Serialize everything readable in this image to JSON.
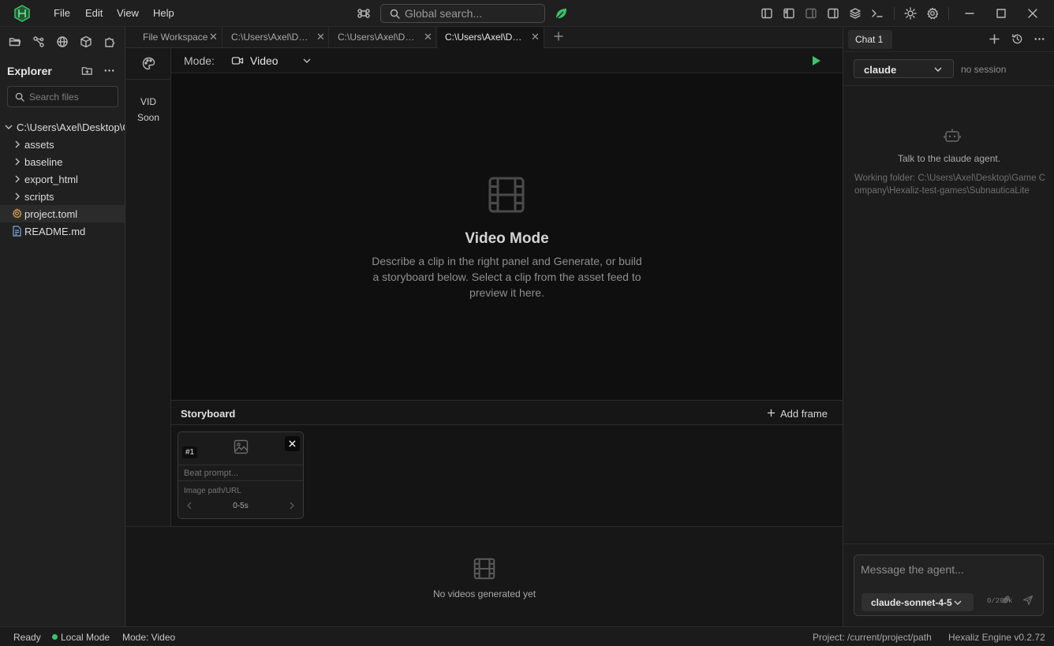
{
  "window": {
    "menu": [
      "File",
      "Edit",
      "View",
      "Help"
    ],
    "global_search_placeholder": "Global search...",
    "accent_color": "#3ec26b"
  },
  "explorer": {
    "title": "Explorer",
    "search_placeholder": "Search files",
    "root": "C:\\Users\\Axel\\Desktop\\Game Company\\Hexaliz-test-games\\SubnauticaLite",
    "items": [
      {
        "label": "assets",
        "type": "folder"
      },
      {
        "label": "baseline",
        "type": "folder"
      },
      {
        "label": "export_html",
        "type": "folder"
      },
      {
        "label": "scripts",
        "type": "folder"
      },
      {
        "label": "project.toml",
        "type": "config-file"
      },
      {
        "label": "README.md",
        "type": "markdown-file"
      }
    ]
  },
  "tabs": [
    {
      "label": "File Workspace"
    },
    {
      "label": "C:\\Users\\Axel\\Desktop"
    },
    {
      "label": "C:\\Users\\Axel\\Desktop"
    },
    {
      "label": "C:\\Users\\Axel\\Desktop"
    }
  ],
  "mode_side": {
    "badge": "VID",
    "note": "Soon"
  },
  "mode_bar": {
    "label": "Mode:",
    "value": "Video"
  },
  "preview": {
    "title": "Video Mode",
    "description": "Describe a clip in the right panel and Generate, or build a storyboard below. Select a clip from the asset feed to preview it here."
  },
  "storyboard": {
    "title": "Storyboard",
    "add_frame_label": "Add frame",
    "frames": [
      {
        "number": "#1",
        "prompt_placeholder": "Beat prompt...",
        "image_placeholder": "Image path/URL",
        "timing": "0-5s"
      }
    ]
  },
  "asset_feed": {
    "empty_text": "No videos generated yet"
  },
  "chat": {
    "tab_label": "Chat 1",
    "agent": "claude",
    "session_status": "no session",
    "empty_title": "Talk to the claude agent.",
    "working_folder_label": "Working folder:",
    "working_folder": "C:\\Users\\Axel\\Desktop\\Game Company\\Hexaliz-test-games\\SubnauticaLite",
    "message_placeholder": "Message the agent...",
    "model": "claude-sonnet-4-5",
    "char_count": "0/200k"
  },
  "status": {
    "ready": "Ready",
    "local_mode": "Local Mode",
    "mode": "Mode: Video",
    "project": "Project: /current/project/path",
    "engine": "Hexaliz Engine v0.2.72",
    "local_mode_color": "#3ec26b"
  }
}
